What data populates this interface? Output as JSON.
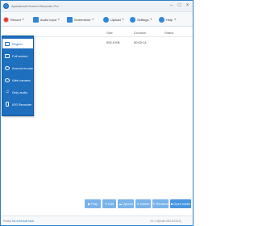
{
  "window": {
    "title": "Apowersoft Screen Recorder Pro",
    "controls": [
      "minimize",
      "maximize",
      "close"
    ]
  },
  "toolbar": {
    "record_label": "Record",
    "audio_label": "Audio input",
    "screenshot_label": "Screenshot",
    "upload_label": "Upload",
    "settings_label": "Settings",
    "help_label": "Help"
  },
  "list": {
    "columns": [
      "Size",
      "Duration",
      "Status"
    ],
    "rows": [
      {
        "size": "592.5 KB",
        "duration": "00:00:14",
        "status": ""
      }
    ]
  },
  "record_menu": {
    "items": [
      {
        "label": "Region",
        "icon": "region-icon",
        "active": true
      },
      {
        "label": "Full screen",
        "icon": "monitor-icon",
        "active": false
      },
      {
        "label": "Around mouse",
        "icon": "mouse-area-icon",
        "active": false
      },
      {
        "label": "Web camera",
        "icon": "webcam-icon",
        "active": false
      },
      {
        "label": "Only audio",
        "icon": "music-note-icon",
        "active": false
      },
      {
        "label": "iOS Recorder",
        "icon": "phone-icon",
        "active": false
      }
    ]
  },
  "actions": {
    "play": "Play",
    "edit": "Edit",
    "upload": "Upload",
    "delete": "Delete",
    "rename": "Rename",
    "open_folder": "Open folder"
  },
  "status": {
    "prefix": "Ready",
    "link": "No schedule task",
    "version": "V2.1.3(Build 08/13/2015)"
  },
  "colors": {
    "accent": "#1e6fbd",
    "button": "#79b3ea",
    "button_primary": "#4796e0"
  }
}
